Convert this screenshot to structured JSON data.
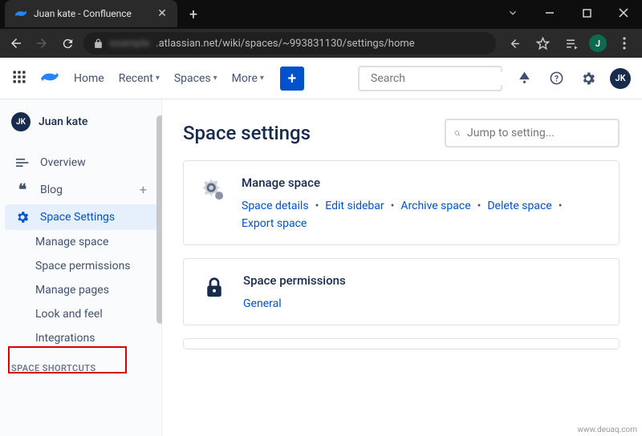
{
  "browser": {
    "tab_title": "Juan kate - Confluence",
    "url_visible": ".atlassian.net/wiki/spaces/~993831130/settings/home",
    "avatar_letter": "J"
  },
  "topnav": {
    "links": [
      "Home",
      "Recent",
      "Spaces",
      "More"
    ],
    "search_placeholder": "Search",
    "avatar_initials": "JK"
  },
  "sidebar": {
    "user_initials": "JK",
    "user_name": "Juan kate",
    "items": [
      {
        "label": "Overview"
      },
      {
        "label": "Blog"
      },
      {
        "label": "Space Settings"
      }
    ],
    "sub_items": [
      "Manage space",
      "Space permissions",
      "Manage pages",
      "Look and feel",
      "Integrations"
    ],
    "shortcuts_heading": "SPACE SHORTCUTS"
  },
  "main": {
    "title": "Space settings",
    "jump_placeholder": "Jump to setting...",
    "cards": [
      {
        "title": "Manage space",
        "links": [
          "Space details",
          "Edit sidebar",
          "Archive space",
          "Delete space",
          "Export space"
        ]
      },
      {
        "title": "Space permissions",
        "links": [
          "General"
        ]
      }
    ]
  },
  "watermark": "www.deuaq.com"
}
